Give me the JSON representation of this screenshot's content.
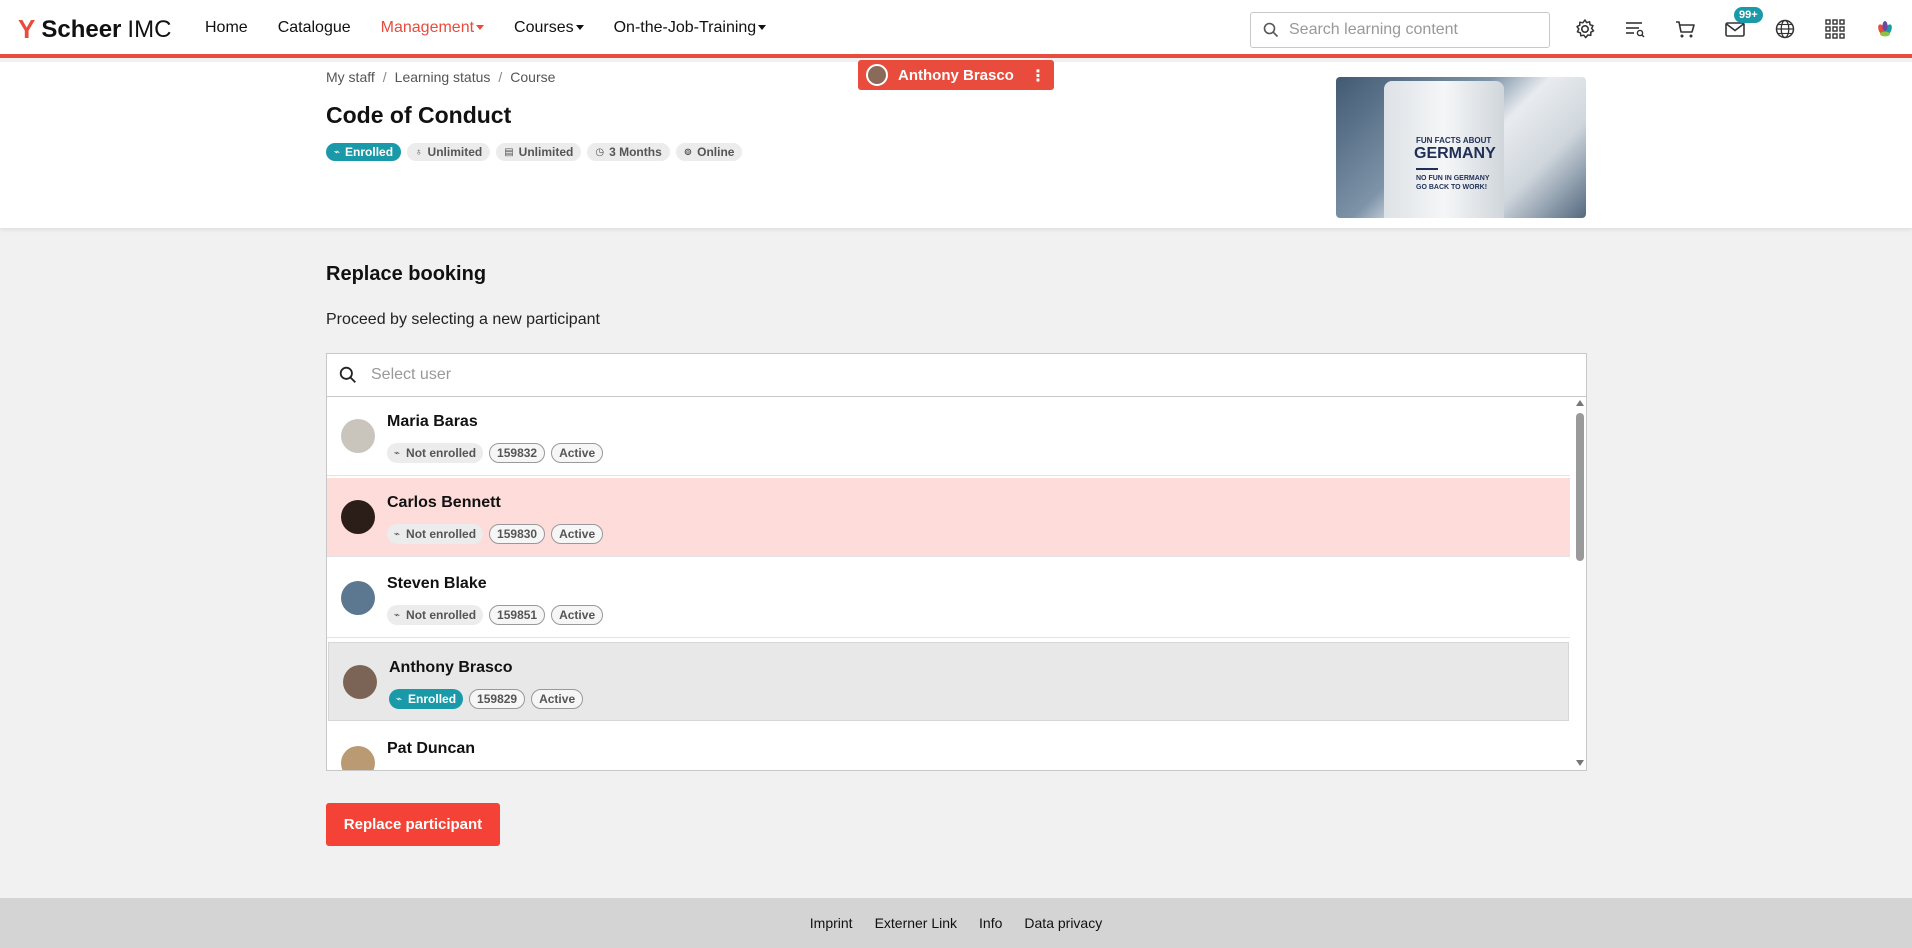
{
  "brand": {
    "mark": "Y",
    "bold": "Scheer",
    "light": "IMC"
  },
  "nav": {
    "items": [
      {
        "label": "Home",
        "active": false,
        "dropdown": false
      },
      {
        "label": "Catalogue",
        "active": false,
        "dropdown": false
      },
      {
        "label": "Management",
        "active": true,
        "dropdown": true
      },
      {
        "label": "Courses",
        "active": false,
        "dropdown": true
      },
      {
        "label": "On-the-Job-Training",
        "active": false,
        "dropdown": true
      }
    ],
    "search_placeholder": "Search learning content",
    "icons": [
      "settings-icon",
      "task-list-icon",
      "cart-icon",
      "mail-icon",
      "globe-icon",
      "apps-grid-icon",
      "brand-flower-icon"
    ],
    "mail_badge": "99+"
  },
  "header": {
    "breadcrumb": [
      "My staff",
      "Learning status",
      "Course"
    ],
    "user_pill": "Anthony Brasco",
    "title": "Code of Conduct",
    "tags": [
      {
        "label": "Enrolled",
        "icon": "activity-icon",
        "primary": true
      },
      {
        "label": "Unlimited",
        "icon": "award-icon",
        "primary": false
      },
      {
        "label": "Unlimited",
        "icon": "document-icon",
        "primary": false
      },
      {
        "label": "3 Months",
        "icon": "clock-icon",
        "primary": false
      },
      {
        "label": "Online",
        "icon": "online-icon",
        "primary": false
      }
    ],
    "image_text": {
      "line1": "FUN FACTS ABOUT",
      "line2": "GERMANY",
      "line3": "NO FUN IN GERMANY",
      "line4": "GO BACK TO WORK!"
    }
  },
  "main": {
    "title": "Replace booking",
    "subtitle": "Proceed by selecting a new participant",
    "search_placeholder": "Select user",
    "users": [
      {
        "name": "Maria Baras",
        "status": "Not enrolled",
        "id": "159832",
        "state": "Active",
        "row": "normal",
        "avatar_color": "#c9c5bd"
      },
      {
        "name": "Carlos Bennett",
        "status": "Not enrolled",
        "id": "159830",
        "state": "Active",
        "row": "hover",
        "avatar_color": "#2b1d17"
      },
      {
        "name": "Steven Blake",
        "status": "Not enrolled",
        "id": "159851",
        "state": "Active",
        "row": "normal",
        "avatar_color": "#5c7790"
      },
      {
        "name": "Anthony Brasco",
        "status": "Enrolled",
        "id": "159829",
        "state": "Active",
        "row": "current",
        "avatar_color": "#7b6455"
      },
      {
        "name": "Pat Duncan",
        "status": "",
        "id": "",
        "state": "",
        "row": "partial",
        "avatar_color": "#b99a72"
      }
    ],
    "button": "Replace participant"
  },
  "footer": {
    "links": [
      "Imprint",
      "Externer Link",
      "Info",
      "Data privacy"
    ]
  },
  "colors": {
    "accent": "#e94b3c",
    "enrolled": "#1a9aa8",
    "hover_row": "#fddcda",
    "current_row": "#e8e8e8"
  }
}
